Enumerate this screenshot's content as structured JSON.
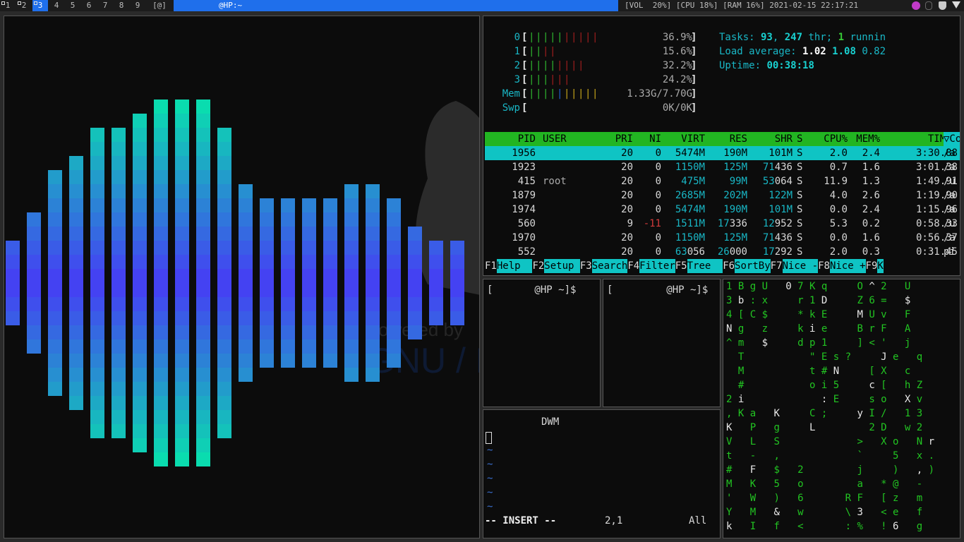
{
  "topbar": {
    "tags": [
      "1",
      "2",
      "3",
      "4",
      "5",
      "6",
      "7",
      "8",
      "9",
      "[@]"
    ],
    "active_tag": 2,
    "window_title": "@HP:~",
    "status": "[VOL  20%] [CPU 18%] [RAM 16%] 2021-02-15 22:17:21"
  },
  "visualizer": {
    "bar_levels": [
      0.26,
      0.43,
      0.65,
      0.75,
      0.85,
      0.85,
      0.95,
      1.0,
      1.0,
      1.0,
      0.85,
      0.55,
      0.45,
      0.45,
      0.45,
      0.45,
      0.55,
      0.55,
      0.45,
      0.35,
      0.25,
      0.25
    ],
    "wallpaper_text": "owered by",
    "wallpaper_text2": "GNU / LINUX"
  },
  "htop": {
    "meters": [
      {
        "label": "0",
        "value": "36.9%"
      },
      {
        "label": "1",
        "value": "15.6%"
      },
      {
        "label": "2",
        "value": "32.2%"
      },
      {
        "label": "3",
        "value": "24.2%"
      },
      {
        "label": "Mem",
        "value": "1.33G/7.70G"
      },
      {
        "label": "Swp",
        "value": "0K/0K"
      }
    ],
    "tasks_label": "Tasks: ",
    "tasks_count": "93",
    "tasks_comma": ", ",
    "tasks_thr": "247",
    "tasks_thr_label": " thr; ",
    "tasks_running": "1",
    "tasks_running_label": " runnin",
    "load_label": "Load average: ",
    "load1": "1.02",
    "load5": "1.08",
    "load15": "0.82",
    "uptime_label": "Uptime: ",
    "uptime": "00:38:18",
    "columns": [
      "PID",
      "USER",
      "PRI",
      "NI",
      "VIRT",
      "RES",
      "SHR",
      "S",
      "CPU%",
      "MEM%",
      "TIME+",
      "▽Co"
    ],
    "processes": [
      {
        "pid": "1956",
        "user": "",
        "pri": "20",
        "ni": "0",
        "virt": "5474M",
        "res": "190M",
        "shr": "101M",
        "s": "S",
        "cpu": "2.0",
        "mem": "2.4",
        "time": "3:30.88",
        "cmd": "/a"
      },
      {
        "pid": "1923",
        "user": "",
        "pri": "20",
        "ni": "0",
        "virt": "1150M",
        "res": "125M",
        "shr": "71436",
        "s": "S",
        "cpu": "0.7",
        "mem": "1.6",
        "time": "3:01.38",
        "cmd": "/a"
      },
      {
        "pid": "415",
        "user": "root",
        "pri": "20",
        "ni": "0",
        "virt": "475M",
        "res": "99M",
        "shr": "53064",
        "s": "S",
        "cpu": "11.9",
        "mem": "1.3",
        "time": "1:49.91",
        "cmd": "/u"
      },
      {
        "pid": "1879",
        "user": "",
        "pri": "20",
        "ni": "0",
        "virt": "2685M",
        "res": "202M",
        "shr": "122M",
        "s": "S",
        "cpu": "4.0",
        "mem": "2.6",
        "time": "1:19.90",
        "cmd": "/a"
      },
      {
        "pid": "1974",
        "user": "",
        "pri": "20",
        "ni": "0",
        "virt": "5474M",
        "res": "190M",
        "shr": "101M",
        "s": "S",
        "cpu": "0.0",
        "mem": "2.4",
        "time": "1:15.96",
        "cmd": "/a"
      },
      {
        "pid": "560",
        "user": "",
        "pri": "9",
        "ni": "-11",
        "virt": "1511M",
        "res": "17336",
        "shr": "12952",
        "s": "S",
        "cpu": "5.3",
        "mem": "0.2",
        "time": "0:58.33",
        "cmd": "/u"
      },
      {
        "pid": "1970",
        "user": "",
        "pri": "20",
        "ni": "0",
        "virt": "1150M",
        "res": "125M",
        "shr": "71436",
        "s": "S",
        "cpu": "0.0",
        "mem": "1.6",
        "time": "0:56.37",
        "cmd": "/a"
      },
      {
        "pid": "552",
        "user": "",
        "pri": "20",
        "ni": "0",
        "virt": "63056",
        "res": "26000",
        "shr": "17292",
        "s": "S",
        "cpu": "2.0",
        "mem": "0.3",
        "time": "0:31.45",
        "cmd": "pi"
      }
    ],
    "fkeys": [
      {
        "num": "F1",
        "label": "Help  "
      },
      {
        "num": "F2",
        "label": "Setup "
      },
      {
        "num": "F3",
        "label": "Search"
      },
      {
        "num": "F4",
        "label": "Filter"
      },
      {
        "num": "F5",
        "label": "Tree  "
      },
      {
        "num": "F6",
        "label": "SortBy"
      },
      {
        "num": "F7",
        "label": "Nice -"
      },
      {
        "num": "F8",
        "label": "Nice +"
      },
      {
        "num": "F9",
        "label": "K"
      }
    ]
  },
  "terminal1": {
    "prompt": "[       @HP ~]$"
  },
  "terminal2": {
    "prompt": "[         @HP ~]$"
  },
  "vim": {
    "buffer_text": "DWM",
    "tildes": [
      "~",
      "~",
      "~",
      "~",
      "~"
    ],
    "mode": "-- INSERT --",
    "position": "2,1",
    "scroll": "All"
  },
  "matrix": {
    "rows": [
      "1 B g U   0 7 K q     O ^ 2   U",
      "3 b : x     r 1 D     Z 6 =   $",
      "4 [ C $     * k E     M U v   F",
      "N g   z     k i e     B r F   A",
      "^ m   $     d p 1     ] < '   j",
      "  T           \" E s ?     J e   q",
      "  M           t # N     [ X   c",
      "  #           o i 5     c [   h Z",
      "2 i             : E     s o   X v",
      ", K a   K     C ;     y I /   1 3",
      "K   P   g     L         2 D   w 2",
      "V   L   S             >   X o   N r",
      "t   -   ,             `     5   x .",
      "#   F   $   2         j     )   , )",
      "M   K   5   o         a   * @   -",
      "'   W   )   6       R F   [ z   m",
      "Y   M   &   w       \\ 3   < e   f",
      "k   I   f   <       : %   ! 6   g"
    ]
  },
  "colors": {
    "accent": "#1f6feb",
    "cyan": "#0fc4c4",
    "htop_header": "#22b522",
    "matrix_green": "#22c422"
  }
}
